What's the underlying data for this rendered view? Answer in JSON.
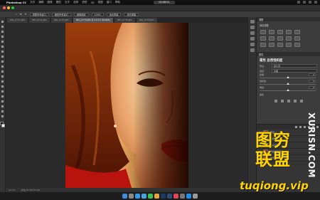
{
  "menubar": {
    "app_name": "Photoshop CC",
    "items": [
      "文件",
      "编辑",
      "图像",
      "图层",
      "文字",
      "选择",
      "滤镜",
      "3D",
      "视图",
      "窗口",
      "帮助"
    ],
    "recording": "00:08:01"
  },
  "options_bar": {
    "tolerance_label": "容差:",
    "items": [
      "调整所有窗口",
      "缩放所有窗口",
      "细微缩放",
      "100%",
      "适合屏幕",
      "填充屏幕"
    ]
  },
  "tabs": [
    {
      "label": "IMG_0771.JPG"
    },
    {
      "label": "IMG_0772.JPG"
    },
    {
      "label": "IMG_0773.JPG"
    },
    {
      "label": "IMG_0774.JPG @ 12.5% (RGB/8)"
    },
    {
      "label": "IMG_0775.JPG"
    },
    {
      "label": "IMG_0776.JPG"
    }
  ],
  "panels": {
    "adjustments_tab": "调整",
    "add_adjustment_label": "添加调整",
    "properties_title": "属性 自然饱和度",
    "preset_label": "预设:",
    "preset_value": "默认值",
    "channel_label": "通道:",
    "channel_value": "全图",
    "sliders": [
      {
        "label": "色相:",
        "value": "0",
        "position": 0.5
      },
      {
        "label": "饱和度:",
        "value": "0",
        "position": 0.5
      },
      {
        "label": "明度:",
        "value": "0",
        "position": 0.5
      }
    ],
    "colorize_label": "着色"
  },
  "layers": {
    "tab": "图层",
    "rows": [
      "背景",
      "色相/饱和度 1",
      "色彩平衡 1",
      "曲线 1",
      "图层 1"
    ]
  },
  "status_bar": {
    "zoom": "12.5%",
    "doc_info": "文档:35.9M/35.9M"
  },
  "watermark": {
    "chinese": "图穷\n联盟",
    "vertical": "XURISN.COM",
    "url": "tuqiong.vip"
  },
  "colors": {
    "watermark_yellow": "#ffd400",
    "ps_dark": "#3c3c3c",
    "canvas_bg": "#2b2b2b"
  }
}
